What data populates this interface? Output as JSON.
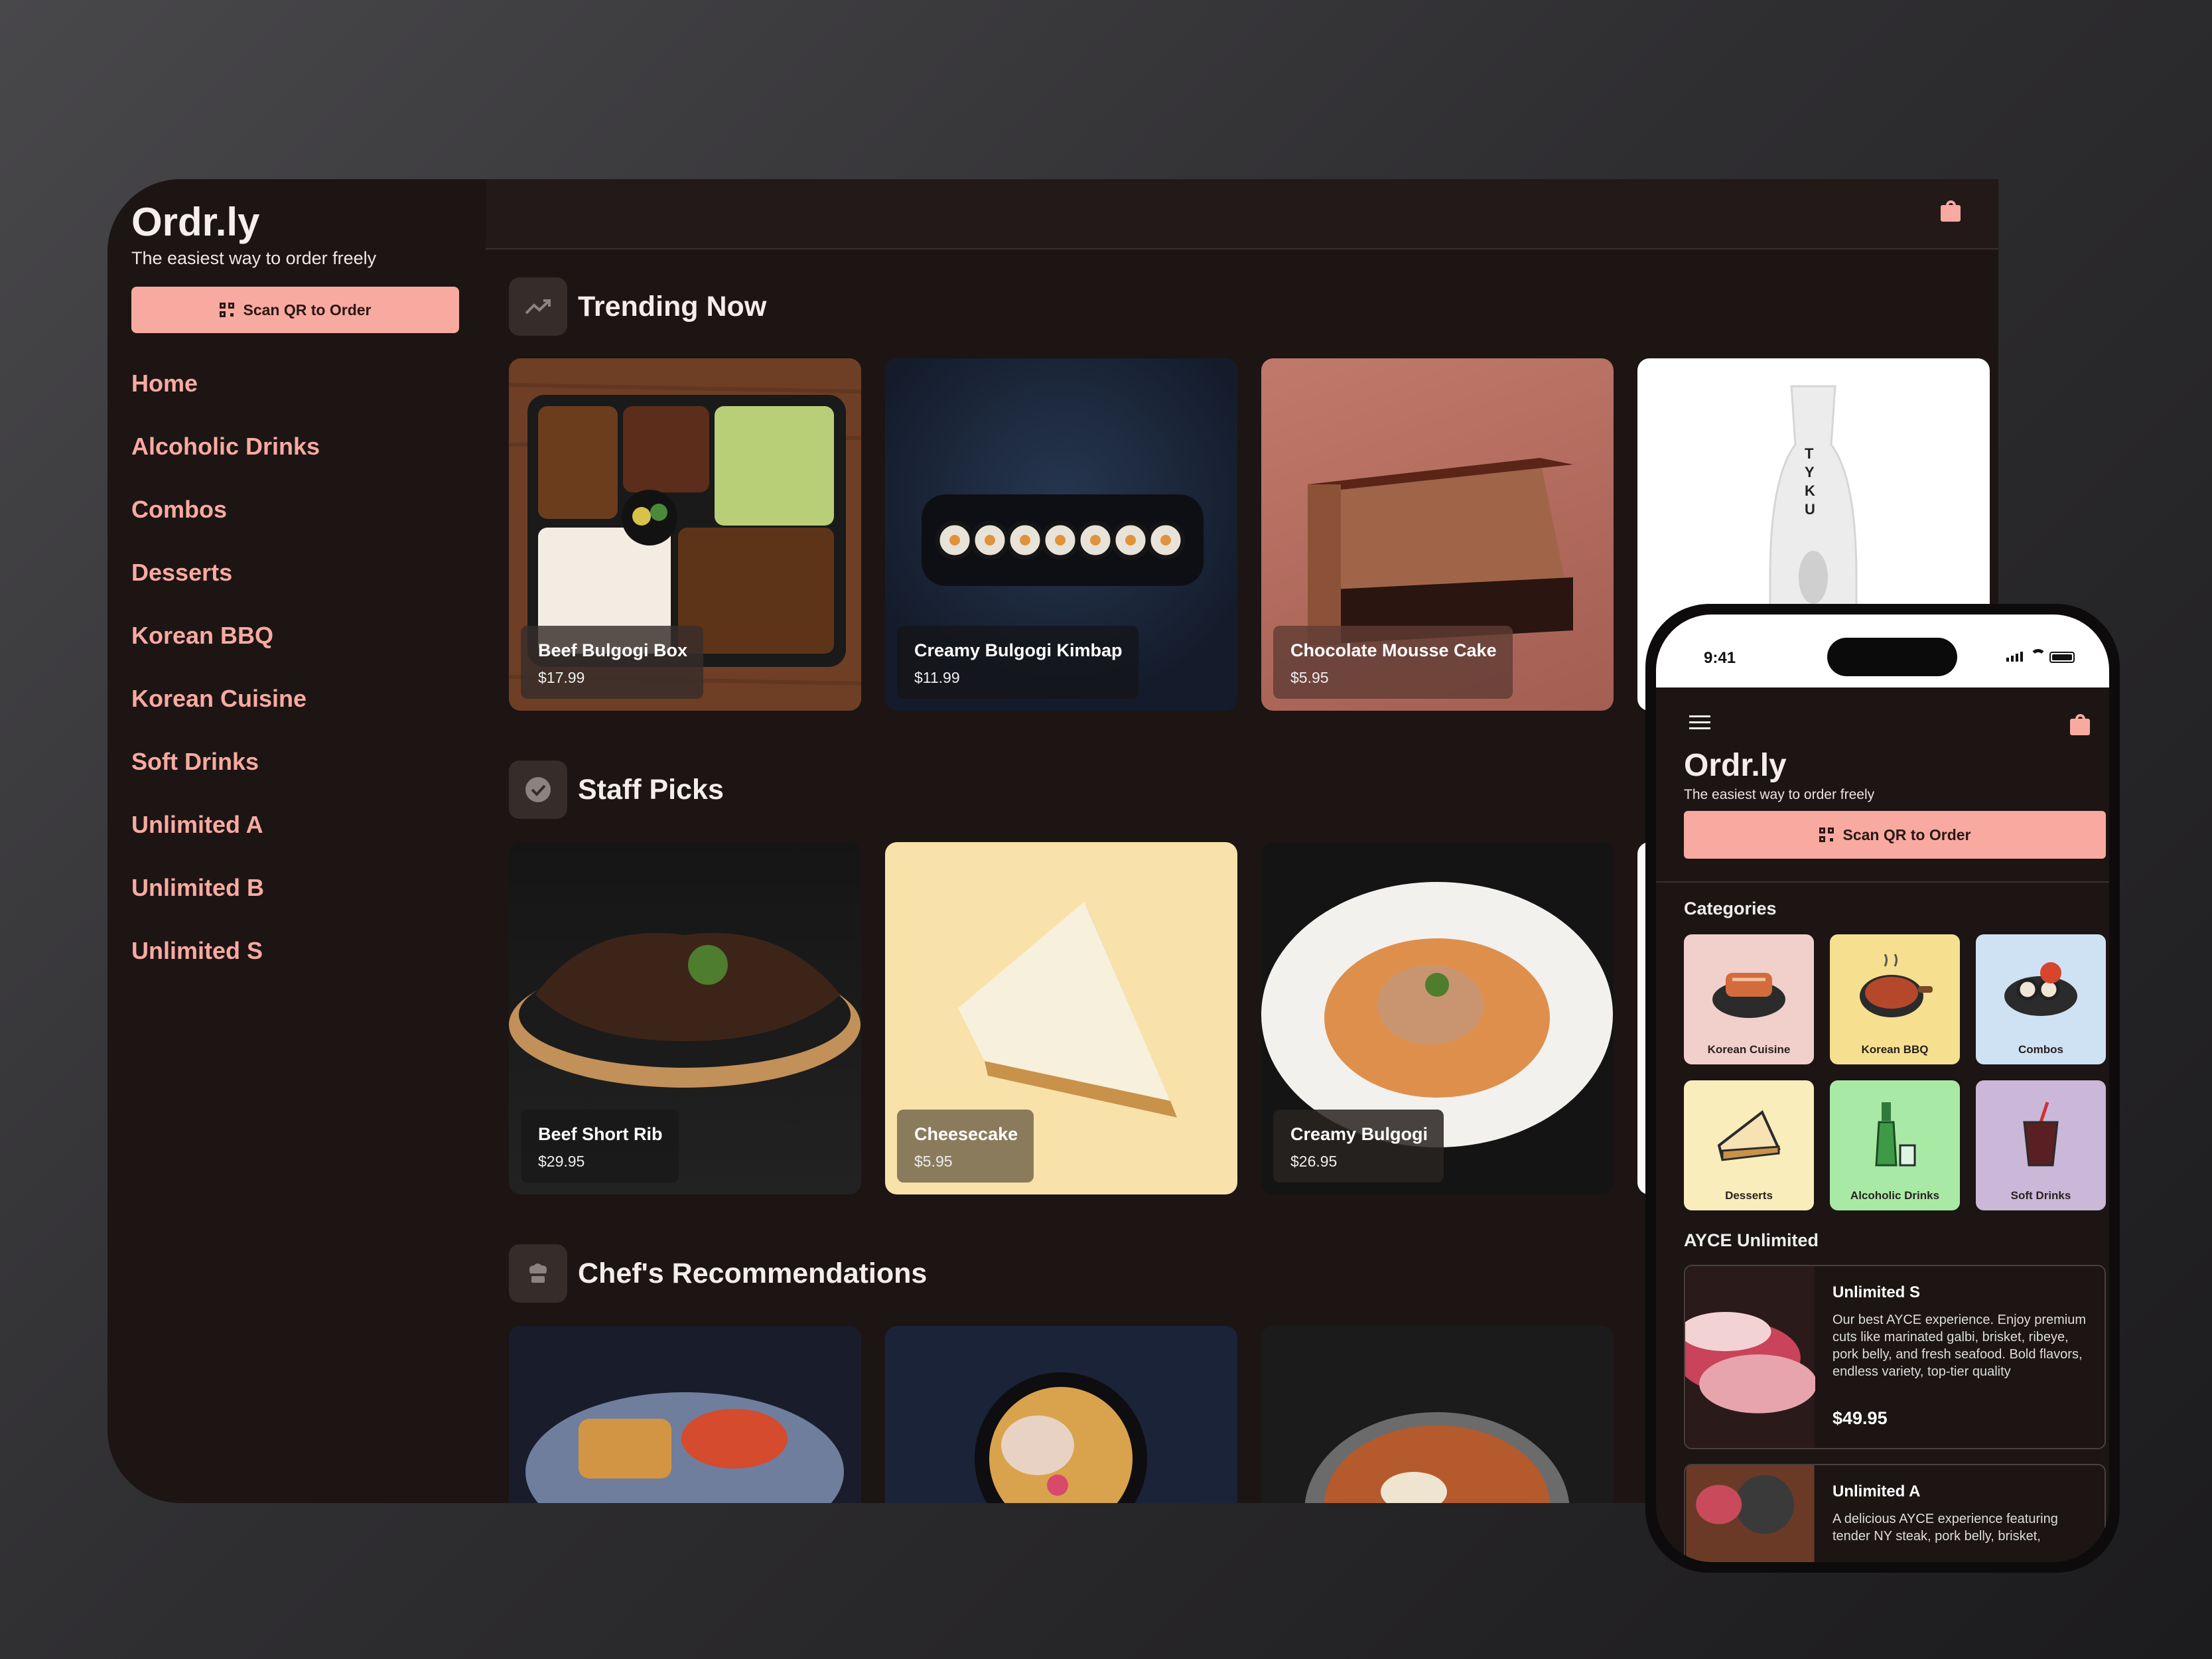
{
  "tablet": {
    "brand": "Ordr.ly",
    "tagline": "The easiest way to order freely",
    "scan_label": "Scan QR to Order",
    "nav": [
      "Home",
      "Alcoholic Drinks",
      "Combos",
      "Desserts",
      "Korean BBQ",
      "Korean Cuisine",
      "Soft Drinks",
      "Unlimited A",
      "Unlimited B",
      "Unlimited S"
    ],
    "sections": [
      {
        "title": "Trending Now",
        "icon": "trending-up-icon",
        "items": [
          {
            "name": "Beef Bulgogi Box",
            "price": "$17.99"
          },
          {
            "name": "Creamy Bulgogi Kimbap",
            "price": "$11.99"
          },
          {
            "name": "Chocolate Mousse Cake",
            "price": "$5.95"
          }
        ]
      },
      {
        "title": "Staff Picks",
        "icon": "verified-badge-icon",
        "items": [
          {
            "name": "Beef Short Rib",
            "price": "$29.95"
          },
          {
            "name": "Cheesecake",
            "price": "$5.95"
          },
          {
            "name": "Creamy Bulgogi",
            "price": "$26.95"
          }
        ]
      },
      {
        "title": "Chef's Recommendations",
        "icon": "chef-hat-icon"
      }
    ],
    "bottle_text": "TYKU",
    "colors": {
      "accent": "#f8aaa0",
      "background": "#1c1514",
      "topbar": "#221918"
    }
  },
  "phone": {
    "time": "9:41",
    "brand": "Ordr.ly",
    "tagline": "The easiest way to order freely",
    "scan_label": "Scan QR to Order",
    "categories_title": "Categories",
    "categories": [
      {
        "label": "Korean Cuisine",
        "color": "#f1cfcb"
      },
      {
        "label": "Korean BBQ",
        "color": "#f6e08f"
      },
      {
        "label": "Combos",
        "color": "#cfe2f3"
      },
      {
        "label": "Desserts",
        "color": "#f9edbb"
      },
      {
        "label": "Alcoholic Drinks",
        "color": "#a8eaa5"
      },
      {
        "label": "Soft Drinks",
        "color": "#cbb8d8"
      }
    ],
    "ayce_title": "AYCE Unlimited",
    "ayce": [
      {
        "name": "Unlimited S",
        "desc": "Our best AYCE experience. Enjoy premium cuts like marinated galbi, brisket, ribeye, pork belly, and fresh seafood. Bold flavors, endless variety, top-tier quality",
        "price": "$49.95"
      },
      {
        "name": "Unlimited A",
        "desc": "A delicious AYCE experience featuring tender NY steak, pork belly, brisket,",
        "price": ""
      }
    ]
  }
}
